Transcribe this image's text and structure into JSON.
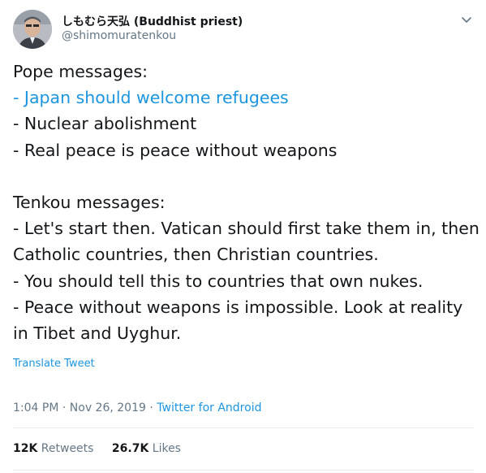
{
  "author": {
    "display_name": "しもむら天弘 (Buddhist priest)",
    "handle": "@shimomuratenkou"
  },
  "icons": {
    "menu": "chevron-down-icon"
  },
  "body": {
    "lines": [
      "Pope messages:",
      "- Japan should welcome refugees",
      "- Nuclear abolishment",
      "- Real peace is peace without weapons",
      "",
      "Tenkou messages:",
      "- Let's start then. Vatican should first take them in, then",
      "Catholic countries, then Christian countries.",
      "- You should tell this to countries that own nukes.",
      "- Peace without weapons is impossible. Look at reality",
      "in Tibet and Uyghur."
    ]
  },
  "translate_label": "Translate Tweet",
  "meta": {
    "time": "1:04 PM",
    "sep1": " · ",
    "date": "Nov 26, 2019",
    "sep2": " · ",
    "source": "Twitter for Android"
  },
  "stats": {
    "retweets_count": "12K",
    "retweets_label": "Retweets",
    "likes_count": "26.7K",
    "likes_label": "Likes"
  },
  "colors": {
    "link": "#1b95e0",
    "secondary": "#657786",
    "text": "#14171a",
    "divider": "#e6ecf0"
  }
}
